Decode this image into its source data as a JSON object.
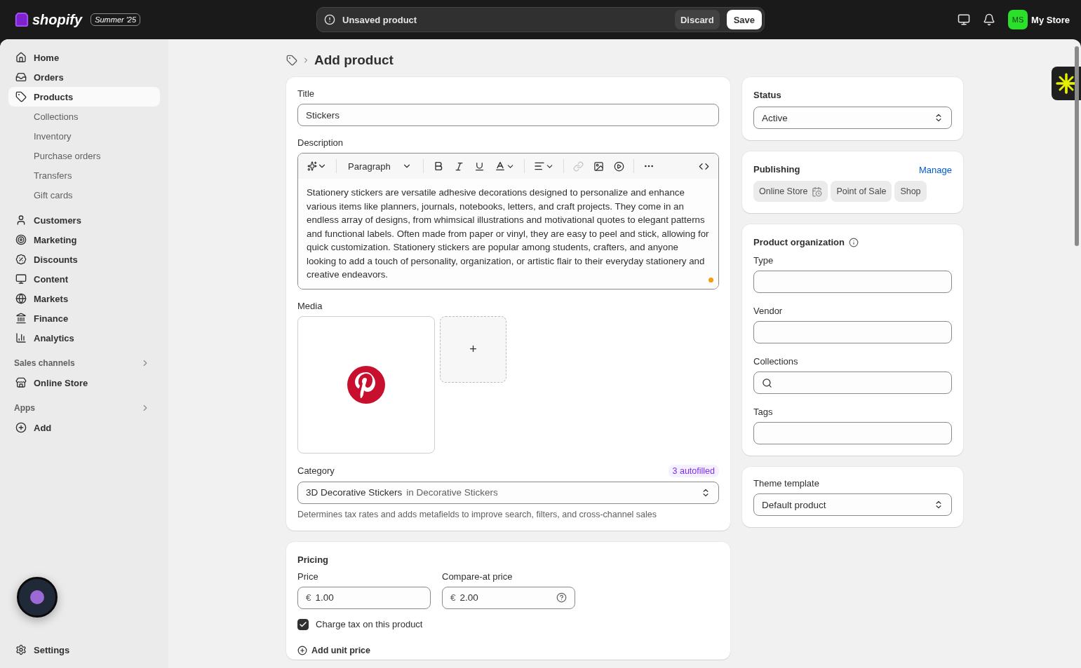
{
  "topbar": {
    "logo": "shopify",
    "edition": "Summer '25",
    "unsaved": {
      "message": "Unsaved product",
      "discard": "Discard",
      "save": "Save"
    },
    "store": {
      "initials": "MS",
      "name": "My Store"
    }
  },
  "sidebar": {
    "items": [
      {
        "label": "Home",
        "selected": false
      },
      {
        "label": "Orders",
        "selected": false
      },
      {
        "label": "Products",
        "selected": true,
        "children": [
          {
            "label": "Collections",
            "selected": false
          },
          {
            "label": "Inventory",
            "selected": false
          },
          {
            "label": "Purchase orders",
            "selected": false
          },
          {
            "label": "Transfers",
            "selected": false
          },
          {
            "label": "Gift cards",
            "selected": false
          }
        ]
      },
      {
        "label": "Customers",
        "selected": false
      },
      {
        "label": "Marketing",
        "selected": false
      },
      {
        "label": "Discounts",
        "selected": false
      },
      {
        "label": "Content",
        "selected": false
      },
      {
        "label": "Markets",
        "selected": false
      },
      {
        "label": "Finance",
        "selected": false
      },
      {
        "label": "Analytics",
        "selected": false
      }
    ],
    "sections": [
      {
        "title": "Sales channels",
        "items": [
          {
            "label": "Online Store",
            "selected": false
          }
        ]
      },
      {
        "title": "Apps",
        "items": [
          {
            "label": "Add",
            "selected": false
          }
        ]
      }
    ],
    "footer": "Settings"
  },
  "page": {
    "title": "Add product"
  },
  "product": {
    "title_label": "Title",
    "title_value": "Stickers",
    "description_label": "Description",
    "block_format": "Paragraph",
    "description": "Stationery stickers are versatile adhesive decorations designed to personalize and enhance various items like planners, journals, notebooks, letters, and craft projects. They come in an endless array of designs, from whimsical illustrations and motivational quotes to elegant patterns and functional labels. Often made from paper or vinyl, they are easy to peel and stick, allowing for quick customization. Stationery stickers are popular among students, crafters, and anyone looking to add a touch of personality, organization, or artistic flair to their everyday stationery and creative endeavors.",
    "media_label": "Media",
    "add_media": "+",
    "category_label": "Category",
    "autofilled": "3 autofilled",
    "category_value": "3D Decorative Stickers",
    "category_context": "in Decorative Stickers",
    "category_help": "Determines tax rates and adds metafields to improve search, filters, and cross-channel sales"
  },
  "pricing": {
    "title": "Pricing",
    "price_label": "Price",
    "price_prefix": "€",
    "price_value": "1.00",
    "compare_label": "Compare-at price",
    "compare_prefix": "€",
    "compare_value": "2.00",
    "charge_tax": {
      "label": "Charge tax on this product",
      "checked": true
    },
    "unit_price": "Add unit price"
  },
  "status": {
    "title": "Status",
    "value": "Active"
  },
  "publishing": {
    "title": "Publishing",
    "manage": "Manage",
    "channels": [
      {
        "label": "Online Store",
        "scheduled": true
      },
      {
        "label": "Point of Sale",
        "scheduled": false
      },
      {
        "label": "Shop",
        "scheduled": false
      }
    ]
  },
  "organization": {
    "title": "Product organization",
    "fields": [
      {
        "label": "Type",
        "kind": "text"
      },
      {
        "label": "Vendor",
        "kind": "text"
      },
      {
        "label": "Collections",
        "kind": "search"
      },
      {
        "label": "Tags",
        "kind": "text"
      }
    ]
  },
  "theme": {
    "title": "Theme template",
    "value": "Default product"
  }
}
